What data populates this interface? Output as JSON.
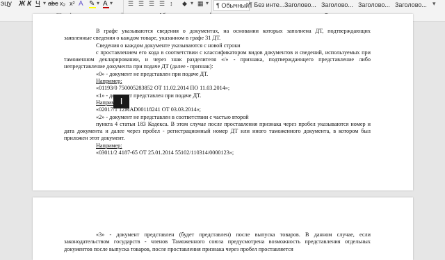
{
  "ribbon": {
    "font_group_row": {
      "fragment": "эцу",
      "bold": "Ж",
      "italic": "К",
      "underline": "Ч",
      "strike": "abc",
      "subscript": "x₂",
      "superscript": "x²"
    },
    "groups": {
      "font": "Шрифт",
      "paragraph": "Абзац",
      "styles": "Стили"
    },
    "styles": [
      "¶ Обычный",
      "¶ Без инте...",
      "Заголово...",
      "Заголово...",
      "Заголово...",
      "Заголово..."
    ],
    "colors": {
      "highlight": "#ffff00",
      "font_color": "#c00000"
    }
  },
  "page1": {
    "lines": [
      "В графе указываются сведения о документах, на основании которых заполнена ДТ, подтверждающих",
      "заявленные сведения о каждом товаре, указанном в графе 31 ДТ.",
      "Сведения о каждом документе указываются с новой строки",
      "с проставлением его кода в соответствии с классификатором видов документов и сведений,",
      "используемых при таможенном декларировании, и через знак разделителя «/» - признака, подтверждающего",
      "представление либо непредставление документа при подаче ДТ (далее - признак):",
      "«0» - документ не представлен при подаче ДТ.",
      "Например:",
      "«01193/0 750005283852 ОТ 11.02.2014 ПО 11.03.2014»;",
      "«1» - документ представлен при подаче ДТ.",
      "Например:",
      "«02017/1 12MAD00118241 ОТ 03.03.2014»;",
      "«2» - документ не представлен в соответствии с частью второй",
      "пункта 4 статьи 183 Кодекса. В этом случае после проставления признака через пробел указываются",
      "номер и дата документа и далее через пробел - регистрационный номер ДТ или иного таможенного",
      "документа, в котором был приложен этот документ.",
      "Например:",
      "«03011/2 4187-65 ОТ 25.01.2014 55102/110314/0000123»;"
    ]
  },
  "page2": {
    "lines": [
      "«3» - документ представлен (будет представлен) после выпуска товаров. В данном случае, если",
      "законодательством государств - членов Таможенного союза предусмотрена возможность представления",
      "отдельных документов после выпуска товаров, после проставления признака через пробел проставляется"
    ]
  },
  "cursor_icon": "I"
}
